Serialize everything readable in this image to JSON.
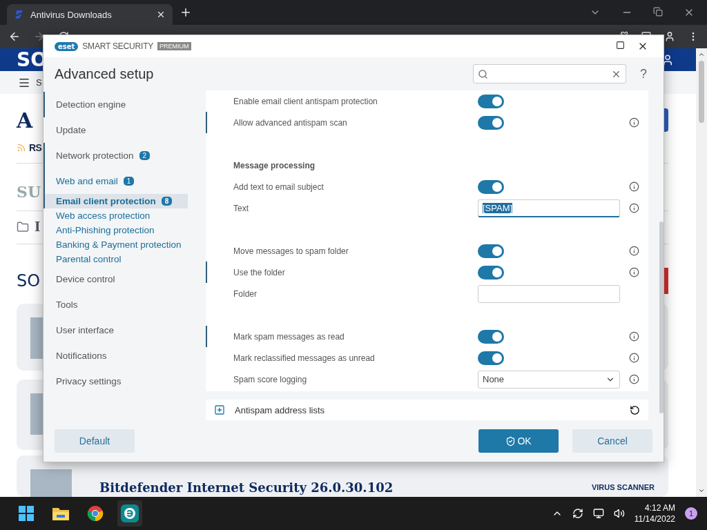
{
  "browser": {
    "tab_title": "Antivirus Downloads"
  },
  "page": {
    "logo": "SO",
    "nav_text": "S",
    "heading": "A",
    "rss": "RS",
    "section_1": "SU",
    "folder_text": "I",
    "section_2": "SO",
    "card_title": "Bitdefender Internet Security 26.0.30.102",
    "card_tag": "VIRUS SCANNER"
  },
  "dialog": {
    "brand": "eset",
    "product": "SMART SECURITY",
    "edition": "PREMIUM",
    "title": "Advanced setup",
    "help": "?",
    "sidebar": [
      {
        "label": "Detection engine",
        "modified": true,
        "selected": false
      },
      {
        "label": "Update",
        "modified": false,
        "selected": false
      },
      {
        "label": "Network protection",
        "badge": "2",
        "modified": true,
        "selected": false
      },
      {
        "label": "Web and email",
        "badge": "1",
        "modified": true,
        "selected": false,
        "expanded": true,
        "children": [
          {
            "label": "Email client protection",
            "badge": "8",
            "modified": true,
            "selected": true
          },
          {
            "label": "Web access protection",
            "modified": false,
            "selected": false
          },
          {
            "label": "Anti-Phishing protection",
            "modified": false,
            "selected": false
          },
          {
            "label": "Banking & Payment protection",
            "modified": false,
            "selected": false
          },
          {
            "label": "Parental control",
            "modified": false,
            "selected": false
          }
        ]
      },
      {
        "label": "Device control",
        "modified": false,
        "selected": false
      },
      {
        "label": "Tools",
        "modified": false,
        "selected": false
      },
      {
        "label": "User interface",
        "modified": false,
        "selected": false
      },
      {
        "label": "Notifications",
        "modified": false,
        "selected": false
      },
      {
        "label": "Privacy settings",
        "modified": false,
        "selected": false
      }
    ],
    "groups": [
      {
        "rows": [
          {
            "kind": "toggle",
            "label": "Enable email client antispam protection",
            "on": true,
            "info": false,
            "modified": false
          },
          {
            "kind": "toggle",
            "label": "Allow advanced antispam scan",
            "on": true,
            "info": true,
            "modified": true
          }
        ]
      },
      {
        "heading": "Message processing",
        "rows": [
          {
            "kind": "toggle",
            "label": "Add text to email subject",
            "on": true,
            "info": true,
            "modified": false
          },
          {
            "kind": "text",
            "label": "Text",
            "value": "[SPAM]",
            "focused": true,
            "info": true,
            "modified": false
          }
        ]
      },
      {
        "rows": [
          {
            "kind": "toggle",
            "label": "Move messages to spam folder",
            "on": true,
            "info": true,
            "modified": false
          },
          {
            "kind": "toggle",
            "label": "Use the folder",
            "on": true,
            "info": true,
            "modified": true
          },
          {
            "kind": "text",
            "label": "Folder",
            "focused": false,
            "info": false,
            "modified": false
          }
        ]
      },
      {
        "rows": [
          {
            "kind": "toggle",
            "label": "Mark spam messages as read",
            "on": true,
            "info": true,
            "modified": true
          },
          {
            "kind": "toggle",
            "label": "Mark reclassified messages as unread",
            "on": true,
            "info": true,
            "modified": false
          },
          {
            "kind": "select",
            "label": "Spam score logging",
            "value": "None",
            "info": true,
            "modified": false
          }
        ]
      }
    ],
    "section": {
      "label": "Antispam address lists",
      "expanded": false
    },
    "buttons": {
      "default": "Default",
      "ok": "OK",
      "cancel": "Cancel"
    }
  },
  "taskbar": {
    "time": "4:12 AM",
    "date": "11/14/2022",
    "notifications": "1"
  }
}
